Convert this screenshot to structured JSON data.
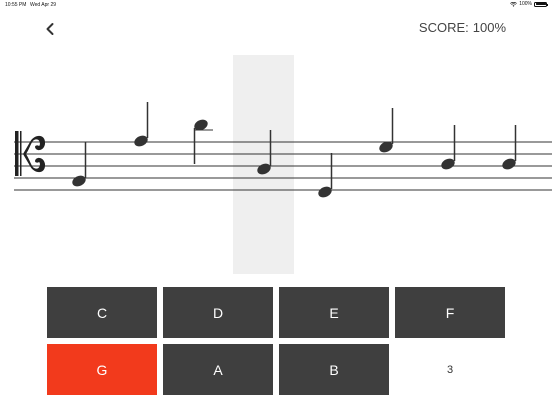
{
  "status_bar": {
    "time": "10:55 PM",
    "date": "Wed Apr 29",
    "battery": "100%"
  },
  "header": {
    "back_icon": "chevron-left-icon",
    "score_label": "SCORE:",
    "score_value": "100%"
  },
  "staff": {
    "clef": "alto-clef-icon",
    "notes": [
      {
        "index": 0,
        "stem": "up"
      },
      {
        "index": 1,
        "stem": "up"
      },
      {
        "index": 2,
        "stem": "down",
        "ledger": true
      },
      {
        "index": 3,
        "stem": "up",
        "highlighted": true
      },
      {
        "index": 4,
        "stem": "up"
      },
      {
        "index": 5,
        "stem": "up"
      },
      {
        "index": 6,
        "stem": "up"
      },
      {
        "index": 7,
        "stem": "up"
      }
    ]
  },
  "answers": {
    "buttons": [
      {
        "label": "C",
        "state": "normal"
      },
      {
        "label": "D",
        "state": "normal"
      },
      {
        "label": "E",
        "state": "normal"
      },
      {
        "label": "F",
        "state": "normal"
      },
      {
        "label": "G",
        "state": "wrong"
      },
      {
        "label": "A",
        "state": "normal"
      },
      {
        "label": "B",
        "state": "normal"
      }
    ],
    "counter": "3"
  },
  "colors": {
    "button_bg": "#3f3f3f",
    "wrong_bg": "#f23a1c",
    "highlight_bg": "#efefef"
  }
}
